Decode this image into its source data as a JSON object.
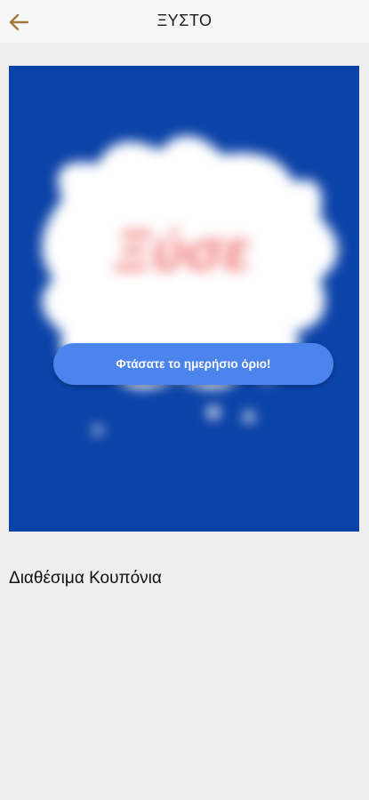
{
  "header": {
    "title": "ΞΥΣΤΟ",
    "back_icon": "arrow-left-icon",
    "accent": "#a07a3c"
  },
  "scratch_card": {
    "background": "#0c43a8",
    "brand_text": "Ξύσε",
    "status_message": "Φτάσατε το ημερήσιο όριο!"
  },
  "coupons": {
    "section_title": "Διαθέσιμα Κουπόνια"
  }
}
